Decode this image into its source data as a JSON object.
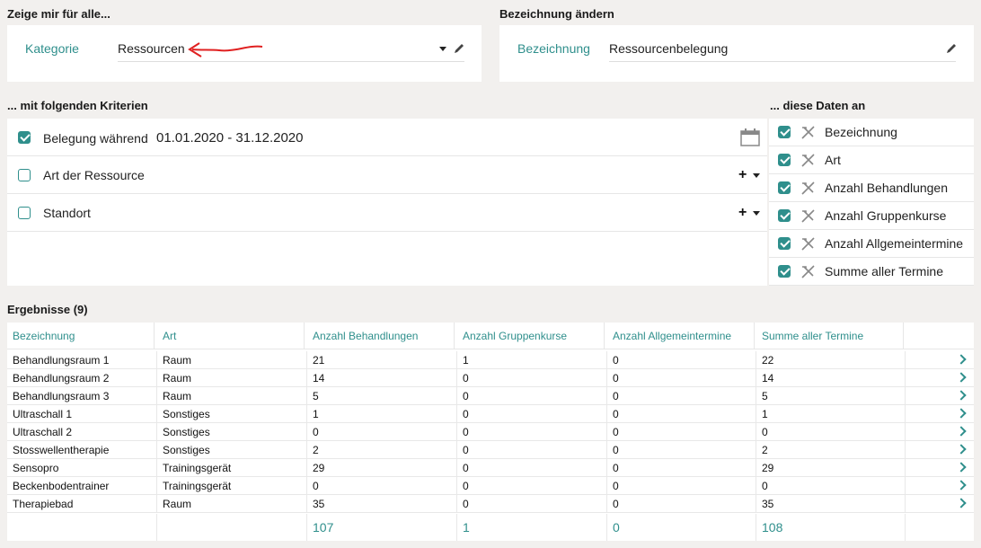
{
  "show_for": {
    "title": "Zeige mir für alle...",
    "label": "Kategorie",
    "value": "Ressourcen"
  },
  "rename": {
    "title": "Bezeichnung ändern",
    "label": "Bezeichnung",
    "value": "Ressourcenbelegung"
  },
  "criteria": {
    "title": "... mit folgenden Kriterien",
    "rows": [
      {
        "label": "Belegung während",
        "value": "01.01.2020 - 31.12.2020",
        "checked": true
      },
      {
        "label": "Art der Ressource",
        "checked": false
      },
      {
        "label": "Standort",
        "checked": false
      }
    ]
  },
  "data_fields": {
    "title": "... diese Daten an",
    "items": [
      {
        "label": "Bezeichnung",
        "checked": true
      },
      {
        "label": "Art",
        "checked": true
      },
      {
        "label": "Anzahl Behandlungen",
        "checked": true
      },
      {
        "label": "Anzahl Gruppenkurse",
        "checked": true
      },
      {
        "label": "Anzahl Allgemeintermine",
        "checked": true
      },
      {
        "label": "Summe aller Termine",
        "checked": true
      }
    ]
  },
  "results": {
    "title": "Ergebnisse (9)",
    "columns": [
      "Bezeichnung",
      "Art",
      "Anzahl Behandlungen",
      "Anzahl Gruppenkurse",
      "Anzahl Allgemeintermine",
      "Summe aller Termine"
    ],
    "rows": [
      [
        "Behandlungsraum 1",
        "Raum",
        "21",
        "1",
        "0",
        "22"
      ],
      [
        "Behandlungsraum 2",
        "Raum",
        "14",
        "0",
        "0",
        "14"
      ],
      [
        "Behandlungsraum 3",
        "Raum",
        "5",
        "0",
        "0",
        "5"
      ],
      [
        "Ultraschall 1",
        "Sonstiges",
        "1",
        "0",
        "0",
        "1"
      ],
      [
        "Ultraschall 2",
        "Sonstiges",
        "0",
        "0",
        "0",
        "0"
      ],
      [
        "Stosswellentherapie",
        "Sonstiges",
        "2",
        "0",
        "0",
        "2"
      ],
      [
        "Sensopro",
        "Trainingsgerät",
        "29",
        "0",
        "0",
        "29"
      ],
      [
        "Beckenbodentrainer",
        "Trainingsgerät",
        "0",
        "0",
        "0",
        "0"
      ],
      [
        "Therapiebad",
        "Raum",
        "35",
        "0",
        "0",
        "35"
      ]
    ],
    "totals": [
      "",
      "",
      "107",
      "1",
      "0",
      "108"
    ]
  },
  "colors": {
    "accent": "#2f8f8c",
    "background": "#f2f0ee",
    "annotation": "#e02020"
  }
}
